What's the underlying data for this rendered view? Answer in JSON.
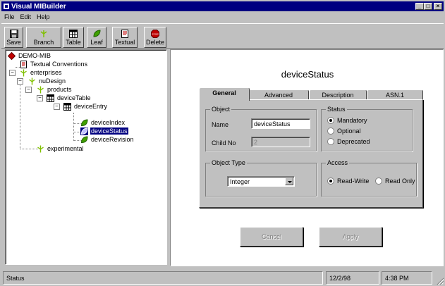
{
  "window": {
    "title": "Visual MIBuilder"
  },
  "menu": {
    "file": "File",
    "edit": "Edit",
    "help": "Help"
  },
  "toolbar": {
    "save": "Save",
    "branch": "Branch",
    "table": "Table",
    "leaf": "Leaf",
    "textual": "Textual",
    "delete": "Delete",
    "stop_text": "STOP"
  },
  "tree": {
    "nodes": [
      {
        "label": "DEMO-MIB",
        "icon": "module-icon"
      },
      {
        "label": "Textual Conventions",
        "icon": "document-icon"
      },
      {
        "label": "enterprises",
        "icon": "branch-icon"
      },
      {
        "label": "nuDesign",
        "icon": "branch-icon"
      },
      {
        "label": "products",
        "icon": "branch-icon"
      },
      {
        "label": "deviceTable",
        "icon": "table-icon"
      },
      {
        "label": "deviceEntry",
        "icon": "table-icon"
      },
      {
        "label": "deviceIndex",
        "icon": "leaf-icon"
      },
      {
        "label": "deviceStatus",
        "icon": "leaf-icon",
        "selected": true
      },
      {
        "label": "deviceRevision",
        "icon": "leaf-icon"
      },
      {
        "label": "experimental",
        "icon": "branch-icon"
      }
    ]
  },
  "detail": {
    "heading": "deviceStatus",
    "tabs": [
      "General",
      "Advanced",
      "Description",
      "ASN.1"
    ],
    "active_tab": "General",
    "object": {
      "group_title": "Object",
      "name_label": "Name",
      "name_value": "deviceStatus",
      "childno_label": "Child No",
      "childno_value": "2"
    },
    "status": {
      "group_title": "Status",
      "options": [
        "Mandatory",
        "Optional",
        "Deprecated"
      ],
      "selected": "Mandatory"
    },
    "object_type": {
      "group_title": "Object Type",
      "value": "Integer"
    },
    "access": {
      "group_title": "Access",
      "options": [
        "Read-Write",
        "Read Only"
      ],
      "selected": "Read-Write"
    },
    "buttons": {
      "cancel": "Cancel",
      "apply": "Apply"
    }
  },
  "statusbar": {
    "text": "Status",
    "date": "12/2/98",
    "time": "4:38 PM"
  },
  "colors": {
    "title_bg": "#000080",
    "face": "#c0c0c0",
    "selection": "#000080",
    "branch_icon": "#80c000",
    "leaf_icon": "#40a000",
    "delete_icon": "#c00000",
    "module_icon": "#c00000"
  }
}
